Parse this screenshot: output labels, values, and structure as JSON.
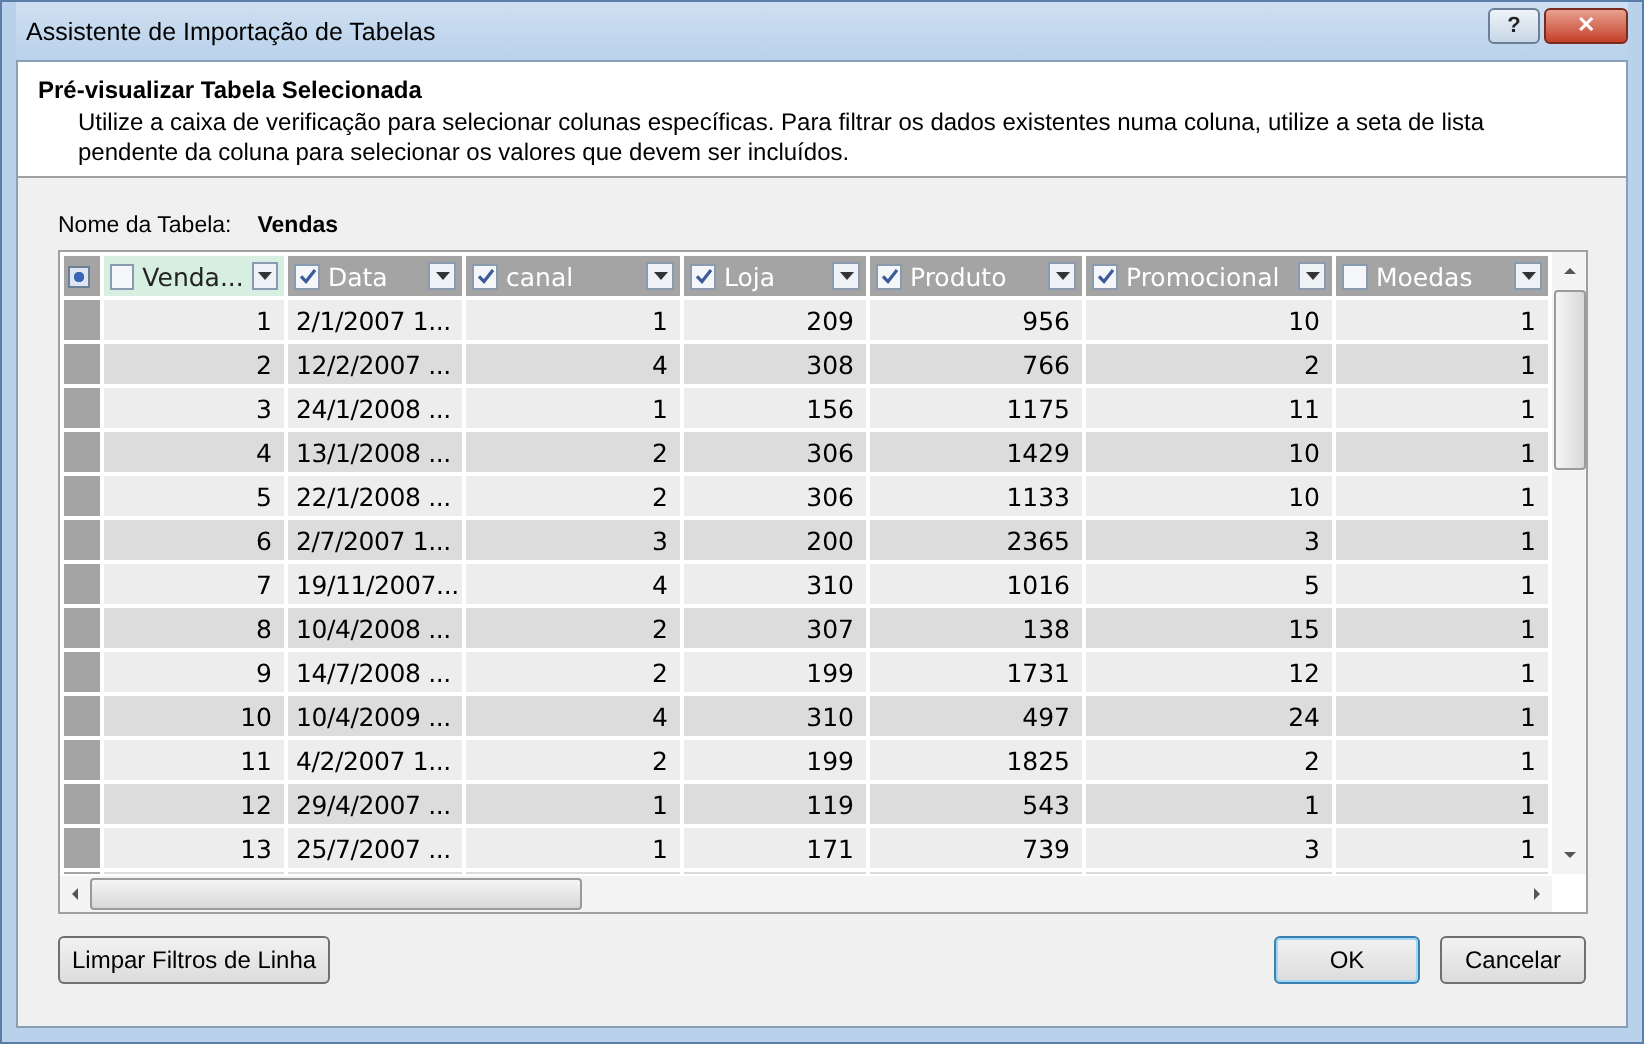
{
  "window": {
    "title": "Assistente de Importação de Tabelas",
    "buttons": [
      {
        "kind": "help",
        "label": "?"
      },
      {
        "kind": "close",
        "label": "✕"
      }
    ]
  },
  "header": {
    "title": "Pré-visualizar Tabela Selecionada",
    "description": "Utilize a caixa de verificação para selecionar colunas específicas. Para filtrar os dados existentes numa coluna, utilize a seta de lista pendente da coluna para selecionar os valores que devem ser incluídos."
  },
  "table_name": {
    "label": "Nome da Tabela:",
    "value": "Vendas"
  },
  "table": {
    "select_all_checked": true,
    "columns": [
      {
        "label": "Venda...",
        "checked": false,
        "selected": true,
        "kind": "number"
      },
      {
        "label": "Data",
        "checked": true,
        "selected": false,
        "kind": "date"
      },
      {
        "label": "canal",
        "checked": true,
        "selected": false,
        "kind": "number"
      },
      {
        "label": "Loja",
        "checked": true,
        "selected": false,
        "kind": "number"
      },
      {
        "label": "Produto",
        "checked": true,
        "selected": false,
        "kind": "number"
      },
      {
        "label": "Promocional",
        "checked": true,
        "selected": false,
        "kind": "number"
      },
      {
        "label": "Moedas",
        "checked": false,
        "selected": false,
        "kind": "number"
      }
    ],
    "rows": [
      [
        "1",
        "2/1/2007 1...",
        "1",
        "209",
        "956",
        "10",
        "1"
      ],
      [
        "2",
        "12/2/2007 ...",
        "4",
        "308",
        "766",
        "2",
        "1"
      ],
      [
        "3",
        "24/1/2008 ...",
        "1",
        "156",
        "1175",
        "11",
        "1"
      ],
      [
        "4",
        "13/1/2008 ...",
        "2",
        "306",
        "1429",
        "10",
        "1"
      ],
      [
        "5",
        "22/1/2008 ...",
        "2",
        "306",
        "1133",
        "10",
        "1"
      ],
      [
        "6",
        "2/7/2007 1...",
        "3",
        "200",
        "2365",
        "3",
        "1"
      ],
      [
        "7",
        "19/11/2007...",
        "4",
        "310",
        "1016",
        "5",
        "1"
      ],
      [
        "8",
        "10/4/2008 ...",
        "2",
        "307",
        "138",
        "15",
        "1"
      ],
      [
        "9",
        "14/7/2008 ...",
        "2",
        "199",
        "1731",
        "12",
        "1"
      ],
      [
        "10",
        "10/4/2009 ...",
        "4",
        "310",
        "497",
        "24",
        "1"
      ],
      [
        "11",
        "4/2/2007 1...",
        "2",
        "199",
        "1825",
        "2",
        "1"
      ],
      [
        "12",
        "29/4/2007 ...",
        "1",
        "119",
        "543",
        "1",
        "1"
      ],
      [
        "13",
        "25/7/2007 ...",
        "1",
        "171",
        "739",
        "3",
        "1"
      ]
    ]
  },
  "footer": {
    "buttons": [
      {
        "kind": "secondary",
        "label": "Limpar Filtros de Linha"
      },
      {
        "kind": "default",
        "label": "OK"
      },
      {
        "kind": "normal",
        "label": "Cancelar"
      }
    ]
  }
}
